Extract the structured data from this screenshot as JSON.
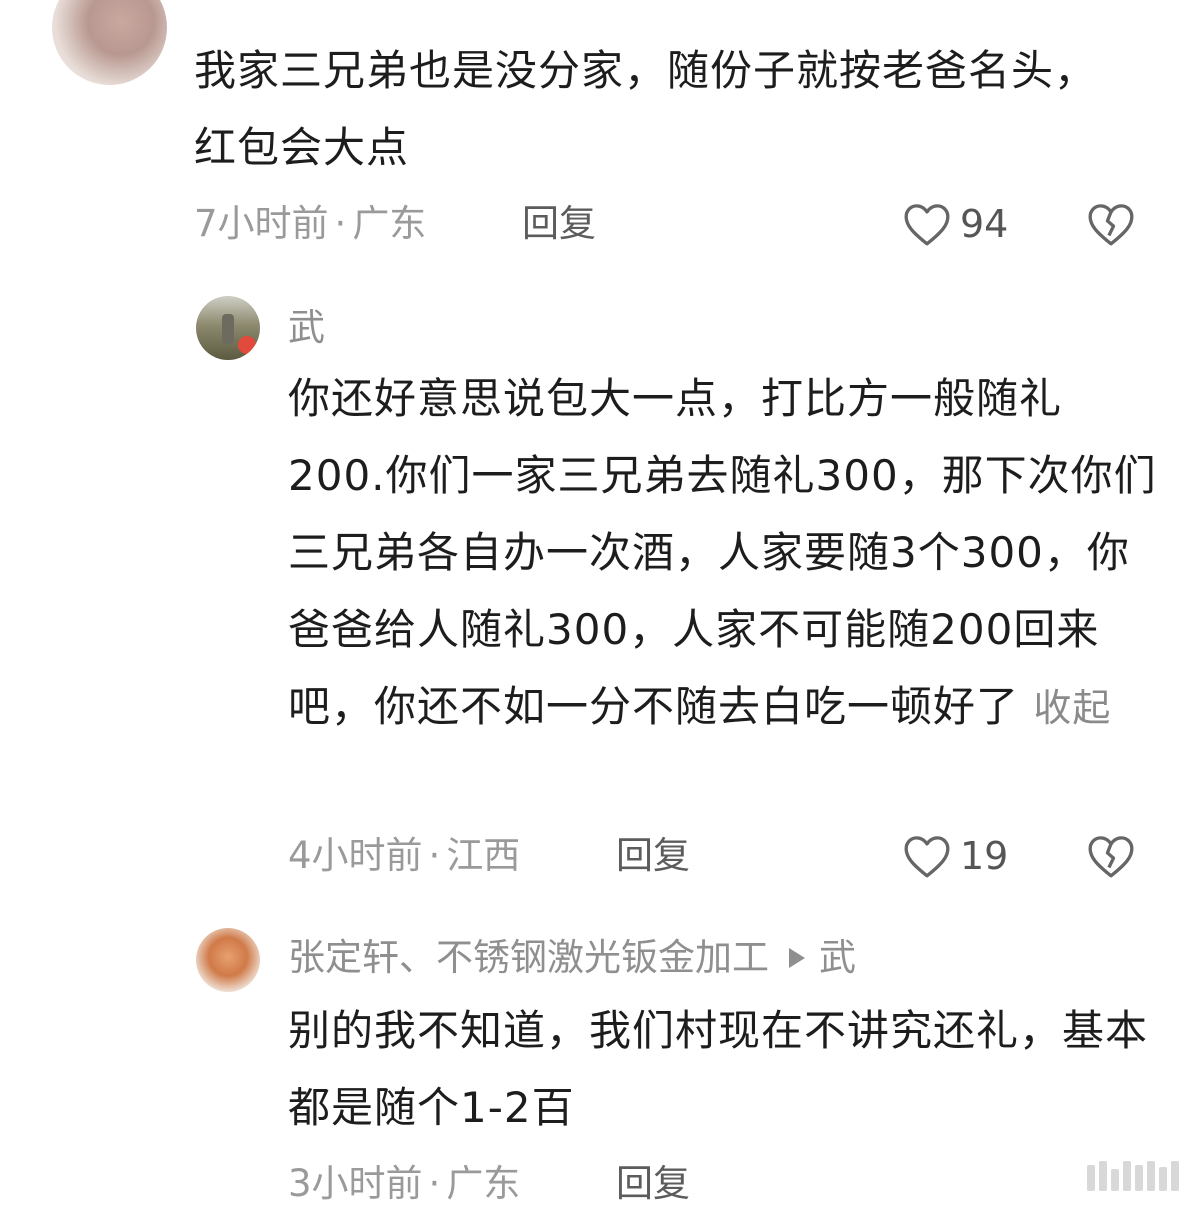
{
  "comments": [
    {
      "text": "我家三兄弟也是没分家，随份子就按老爸名头，红包会大点",
      "time": "7小时前",
      "location": "广东",
      "reply_label": "回复",
      "likes": "94"
    },
    {
      "username": "武",
      "text": "你还好意思说包大一点，打比方一般随礼200.你们一家三兄弟去随礼300，那下次你们三兄弟各自办一次酒，人家要随3个300，你爸爸给人随礼300，人家不可能随200回来吧，你还不如一分不随去白吃一顿好了",
      "collapse_label": "收起",
      "time": "4小时前",
      "location": "江西",
      "reply_label": "回复",
      "likes": "19"
    },
    {
      "username": "张定轩、不锈钢激光钣金加工",
      "reply_to": "武",
      "text": "别的我不知道，我们村现在不讲究还礼，基本都是随个1-2百",
      "time": "3小时前",
      "location": "广东",
      "reply_label": "回复"
    }
  ],
  "separator": "·",
  "icons": {
    "like": "heart-outline-icon",
    "dislike": "broken-heart-icon"
  },
  "colors": {
    "text": "#1d1d1d",
    "meta": "#9a9a9a",
    "icon": "#666666"
  }
}
